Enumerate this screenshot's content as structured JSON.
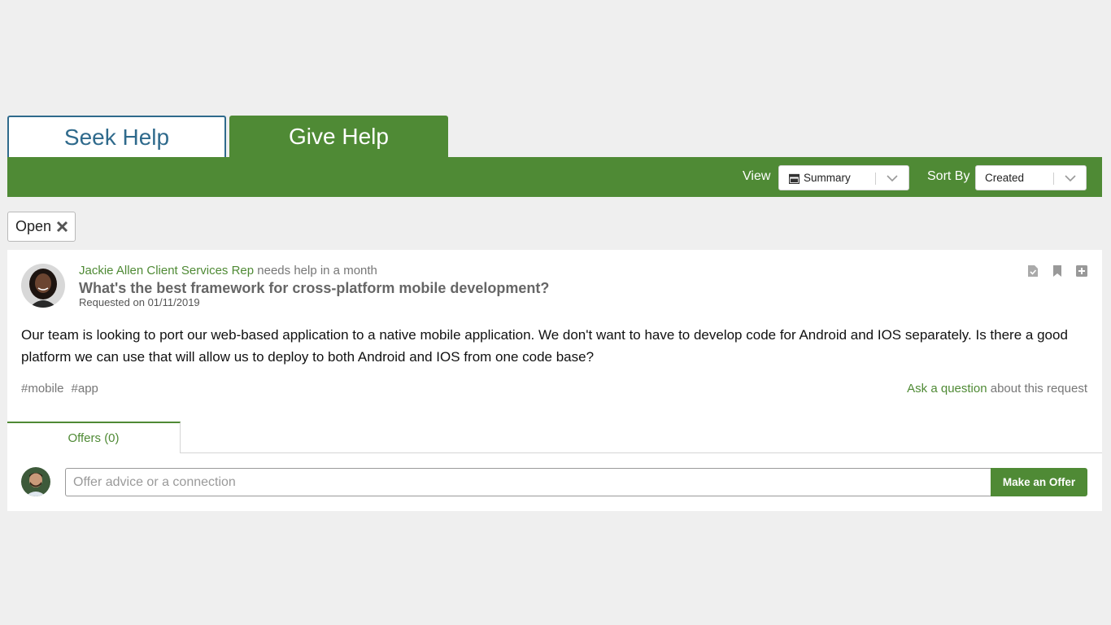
{
  "tabs": {
    "seek_help": "Seek Help",
    "give_help": "Give Help"
  },
  "toolbar": {
    "view_label": "View",
    "view_value": "Summary",
    "sort_label": "Sort By",
    "sort_value": "Created"
  },
  "filter": {
    "chip_label": "Open"
  },
  "request": {
    "author": "Jackie Allen Client Services Rep",
    "needs_text": "needs help in a month",
    "title": "What's the best framework for cross-platform mobile development?",
    "date": "Requested on 01/11/2019",
    "description": "Our team is looking to port our web-based application to a native mobile application. We don't want to have to develop code for Android and IOS separately. Is there a good platform we can use that will allow us to deploy to both Android and IOS from one code base?",
    "tags": [
      "#mobile",
      "#app"
    ],
    "ask_link": "Ask a question",
    "ask_suffix": "about this request"
  },
  "offers": {
    "tab_label": "Offers (0)",
    "input_placeholder": "Offer advice or a connection",
    "button_label": "Make an Offer"
  },
  "colors": {
    "brand_green": "#4f8a35",
    "seek_blue": "#2f6a8c",
    "background": "#efefef"
  },
  "icons": {
    "view_select": "calendar-icon",
    "select_arrow": "chevron-down-icon",
    "chip_remove": "close-icon",
    "card_actions": [
      "document-check-icon",
      "bookmark-icon",
      "plus-square-icon"
    ]
  }
}
